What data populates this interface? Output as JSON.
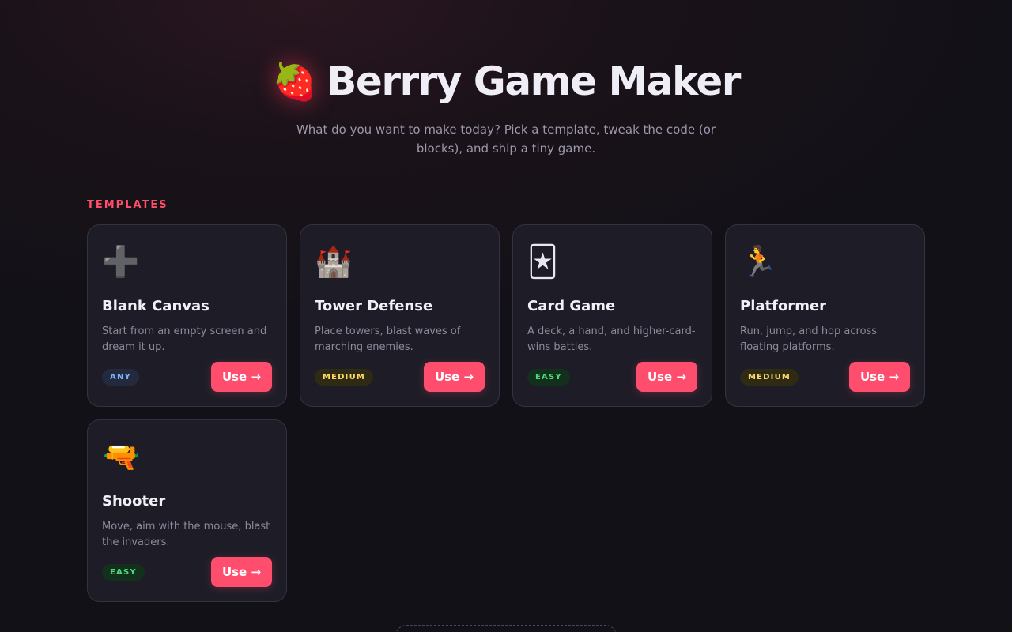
{
  "header": {
    "logo_icon": "strawberry-icon",
    "logo_glyph": "🍓",
    "title": "Berrry Game Maker",
    "subtitle": "What do you want to make today? Pick a template, tweak the code (or blocks), and ship a tiny game."
  },
  "templates": {
    "section_label": "TEMPLATES",
    "items": [
      {
        "icon": "plus-icon",
        "glyph": "➕",
        "title": "Blank Canvas",
        "description": "Start from an empty screen and dream it up.",
        "badge": "ANY",
        "badge_color": "#7fb3ff",
        "button": "Use →"
      },
      {
        "icon": "castle-icon",
        "glyph": "🏰",
        "title": "Tower Defense",
        "description": "Place towers, blast waves of marching enemies.",
        "badge": "MEDIUM",
        "badge_color": "#ffd766",
        "button": "Use →"
      },
      {
        "icon": "joker-card-icon",
        "glyph": "🃏",
        "title": "Card Game",
        "description": "A deck, a hand, and higher-card-wins battles.",
        "badge": "EASY",
        "badge_color": "#4ddb7c",
        "button": "Use →"
      },
      {
        "icon": "runner-icon",
        "glyph": "🏃",
        "title": "Platformer",
        "description": "Run, jump, and hop across floating platforms.",
        "badge": "MEDIUM",
        "badge_color": "#ffd766",
        "button": "Use →"
      },
      {
        "icon": "water-pistol-icon",
        "glyph": "🔫",
        "title": "Shooter",
        "description": "Move, aim with the mouse, blast the invaders.",
        "badge": "EASY",
        "badge_color": "#4ddb7c",
        "button": "Use →"
      }
    ]
  },
  "colors": {
    "accent": "#ff4d6d",
    "background": "#121117",
    "card": "#1e1d27"
  }
}
